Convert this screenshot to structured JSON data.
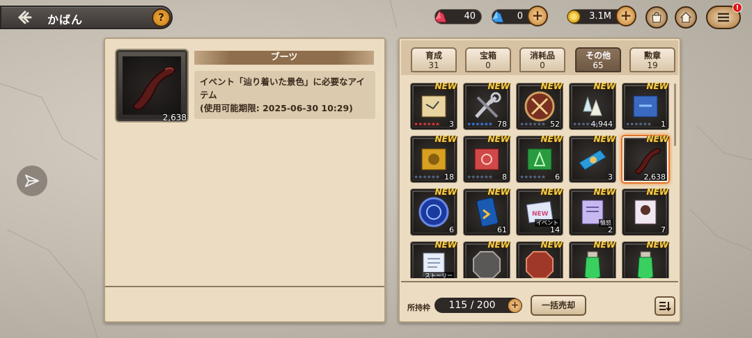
{
  "header": {
    "title": "かばん",
    "help_label": "?"
  },
  "currencies": {
    "red_crystal": "40",
    "blue_crystal": "0",
    "gold": "3.1M"
  },
  "menu": {
    "alert_label": "!"
  },
  "detail": {
    "item_name": "ブーツ",
    "description_line1": "イベント「辿り着いた景色」に必要なアイ",
    "description_line2": "テム",
    "description_line3": "(使用可能期限: 2025-06-30 10:29)",
    "count": "2,638"
  },
  "tabs": [
    {
      "label": "育成",
      "count": "31"
    },
    {
      "label": "宝箱",
      "count": "0"
    },
    {
      "label": "消耗品",
      "count": "0"
    },
    {
      "label": "その他",
      "count": "65"
    },
    {
      "label": "勲章",
      "count": "19"
    }
  ],
  "new_label": "NEW",
  "items": [
    {
      "count": "3",
      "icon": "map-scroll-icon",
      "stars": "★★★★★★"
    },
    {
      "count": "78",
      "icon": "tools-icon",
      "stars": "★★★★★★"
    },
    {
      "count": "52",
      "icon": "emblem-coin-icon",
      "stars": "★★★★★★"
    },
    {
      "count": "4,944",
      "icon": "crystal-shards-icon",
      "stars": "★★★★★★"
    },
    {
      "count": "1",
      "icon": "blue-scroll-icon",
      "stars": "★★★★★★"
    },
    {
      "count": "18",
      "icon": "gold-scroll-icon",
      "stars": "★★★★★★"
    },
    {
      "count": "8",
      "icon": "red-scroll-icon",
      "stars": "★★★★★★"
    },
    {
      "count": "6",
      "icon": "green-scroll-icon",
      "stars": "★★★★★★"
    },
    {
      "count": "3",
      "icon": "ticket-icon",
      "stars": ""
    },
    {
      "count": "2,638",
      "icon": "boot-icon",
      "stars": ""
    },
    {
      "count": "6",
      "icon": "blue-medal-icon",
      "stars": ""
    },
    {
      "count": "61",
      "icon": "blue-card-icon",
      "stars": ""
    },
    {
      "count": "14",
      "icon": "event-ticket-icon",
      "stars": "",
      "tag": "イベント"
    },
    {
      "count": "2",
      "icon": "purple-ticket-icon",
      "stars": "",
      "tag": "憤怒"
    },
    {
      "count": "7",
      "icon": "portrait-ticket-icon",
      "stars": ""
    },
    {
      "count": "",
      "icon": "story-ticket-icon",
      "stars": "",
      "tag": "ストーリー"
    },
    {
      "count": "",
      "icon": "stone-octagon-icon",
      "stars": ""
    },
    {
      "count": "",
      "icon": "red-octagon-icon",
      "stars": ""
    },
    {
      "count": "",
      "icon": "green-potion-icon",
      "stars": ""
    },
    {
      "count": "",
      "icon": "green-potion-icon",
      "stars": ""
    }
  ],
  "footer": {
    "capacity_label": "所持枠",
    "capacity_value": "115 / 200",
    "bulk_sell_label": "一括売却"
  },
  "colors": {
    "panel_bg": "#ecdcc1",
    "active_tab": "#7a6450",
    "selected_glow": "#f08c3c",
    "new_badge": "#f2d050"
  }
}
